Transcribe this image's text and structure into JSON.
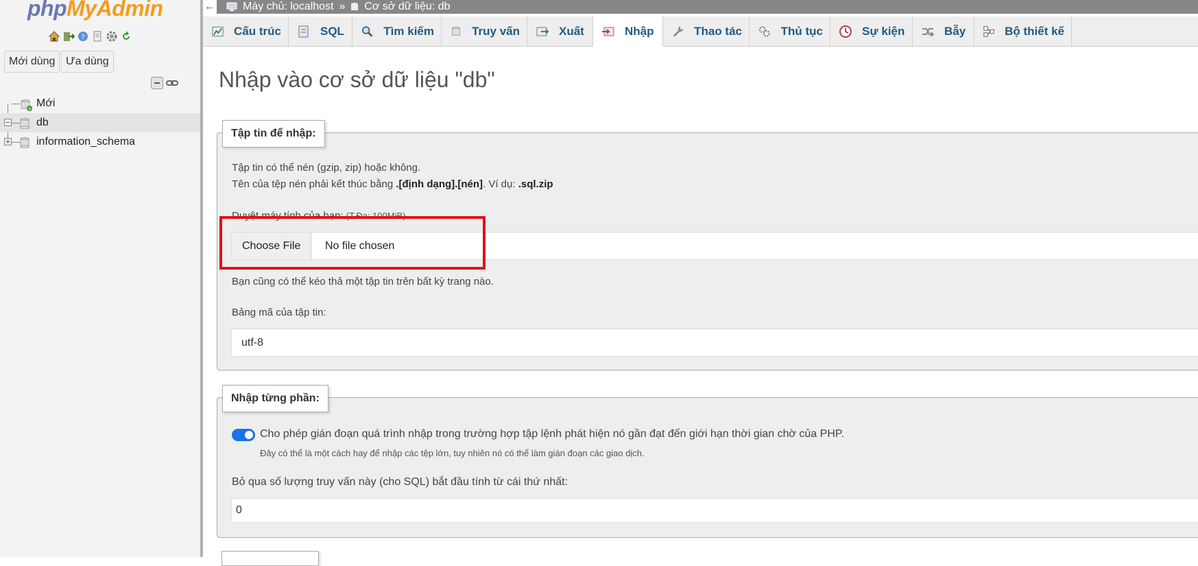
{
  "sidebar": {
    "logo_php": "php",
    "logo_myadmin": "MyAdmin",
    "quick_icons": [
      "home-icon",
      "exit-icon",
      "help-icon",
      "docs-icon",
      "settings-icon",
      "reload-icon"
    ],
    "recent_button": "Mới dùng",
    "favorites_button": "Ưa dùng",
    "tree": [
      {
        "label": "Mới",
        "icon": "new-db-icon"
      },
      {
        "label": "db",
        "icon": "database-icon",
        "expanded": true,
        "active": true
      },
      {
        "label": "information_schema",
        "icon": "database-icon",
        "expanded": false
      }
    ]
  },
  "topbar": {
    "back_glyph": "←",
    "server": "Máy chủ: localhost",
    "separator": "»",
    "database": "Cơ sở dữ liệu: db"
  },
  "tabs": [
    {
      "label": "Cấu trúc",
      "icon": "structure-icon"
    },
    {
      "label": "SQL",
      "icon": "sql-icon"
    },
    {
      "label": "Tìm kiếm",
      "icon": "search-icon"
    },
    {
      "label": "Truy vấn",
      "icon": "query-icon"
    },
    {
      "label": "Xuất",
      "icon": "export-icon"
    },
    {
      "label": "Nhập",
      "icon": "import-icon",
      "active": true
    },
    {
      "label": "Thao tác",
      "icon": "wrench-icon"
    },
    {
      "label": "Thủ tục",
      "icon": "routines-icon"
    },
    {
      "label": "Sự kiện",
      "icon": "clock-icon"
    },
    {
      "label": "Bẫy",
      "icon": "triggers-icon"
    },
    {
      "label": "Bộ thiết kế",
      "icon": "designer-icon"
    }
  ],
  "main": {
    "title": "Nhập vào cơ sở dữ liệu \"db\"",
    "file_section": {
      "legend": "Tập tin để nhập:",
      "line1": "Tập tin có thể nén (gzip, zip) hoặc không.",
      "line2_prefix": "Tên của tệp nén phải kết thúc bằng ",
      "line2_format": ".[định dạng].[nén]",
      "line2_mid": ". Ví dụ: ",
      "line2_example": ".sql.zip",
      "browse_label": "Duyệt máy tính của bạn:",
      "max_size": "(T.Đa: 100MiB)",
      "choose_file": "Choose File",
      "no_file": "No file chosen",
      "drag_hint": "Bạn cũng có thể kéo thả một tập tin trên bất kỳ trang nào.",
      "charset_label": "Bảng mã của tập tin:",
      "charset_value": "utf-8"
    },
    "partial_section": {
      "legend": "Nhập từng phần:",
      "toggle_on": true,
      "toggle_label": "Cho phép gián đoạn quá trình nhập trong trường hợp tập lệnh phát hiện nó gần đạt đến giới hạn thời gian chờ của PHP.",
      "toggle_hint": "Đây có thể là một cách hay để nhập các tệp lớn, tuy nhiên nó có thể làm gián đoạn các giao dịch.",
      "skip_label": "Bỏ qua số lượng truy vấn này (cho SQL) bắt đầu tính từ cái thứ nhất:",
      "skip_value": "0"
    }
  },
  "colors": {
    "tab_text": "#235a81",
    "highlight": "#e0121a",
    "toggle": "#1a73e8",
    "logo_php": "#6c78af",
    "logo_myadmin": "#f29c1f"
  }
}
